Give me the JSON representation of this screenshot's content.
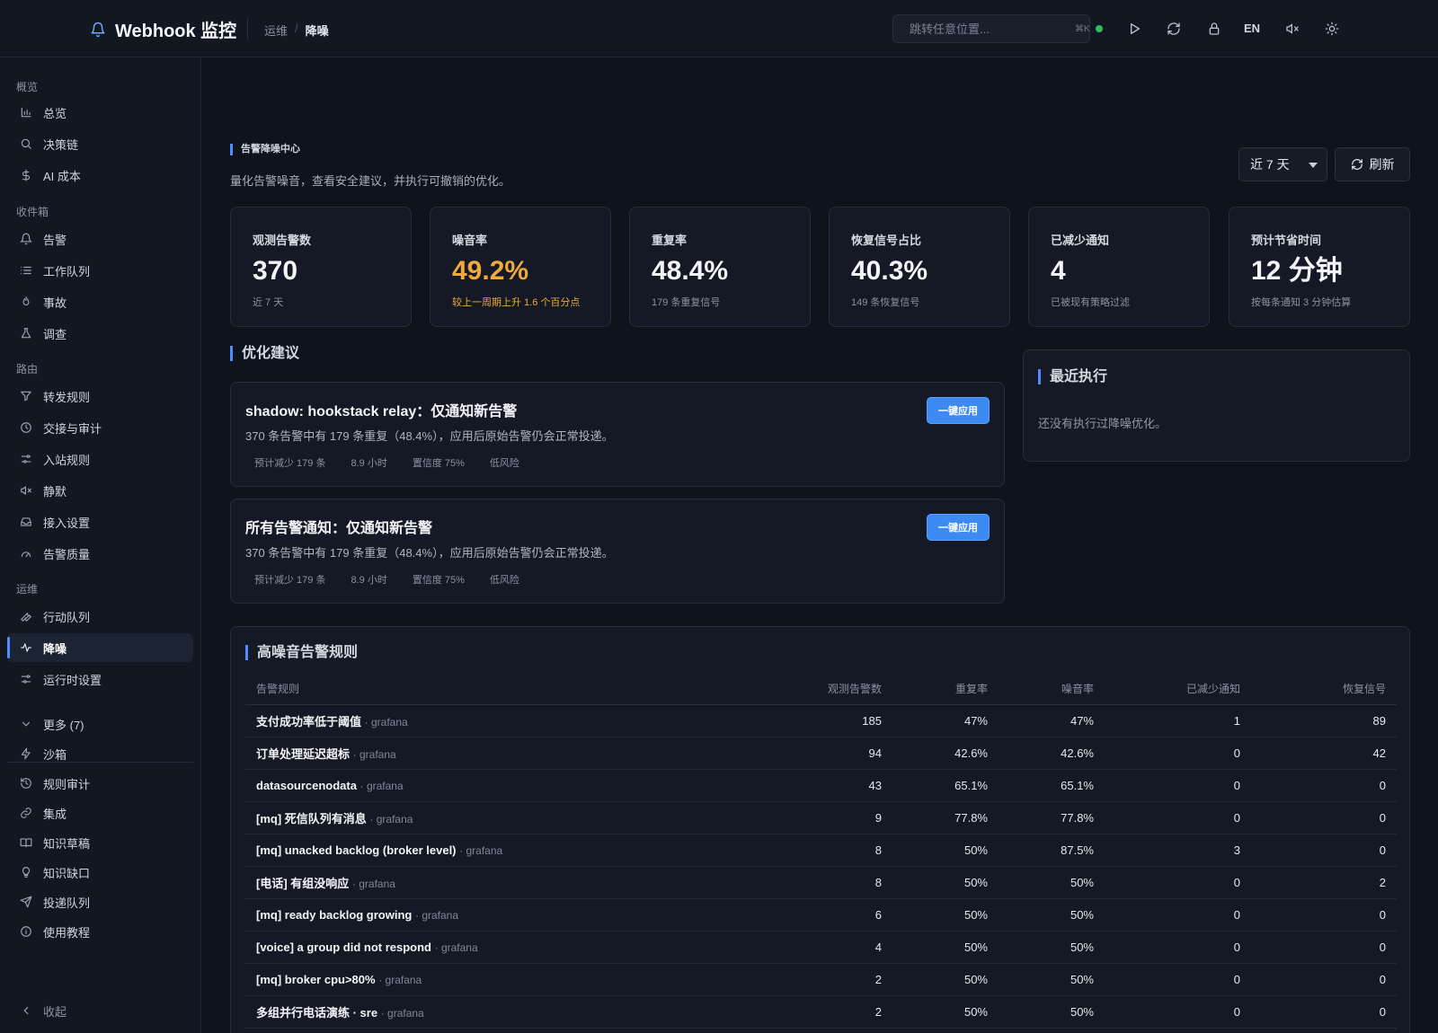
{
  "topbar": {
    "app_title": "Webhook 监控",
    "breadcrumb_parent": "运维",
    "breadcrumb_sep": "/",
    "breadcrumb_current": "降噪",
    "search_placeholder": "跳转任意位置...",
    "search_shortcut": "⌘K",
    "lang": "EN",
    "status_color": "#2fbf5a"
  },
  "sidebar": {
    "sections": [
      "概览",
      "收件箱",
      "路由",
      "运维"
    ],
    "items": [
      {
        "label": "总览",
        "icon": "bar-chart-icon"
      },
      {
        "label": "决策链",
        "icon": "search-icon"
      },
      {
        "label": "AI 成本",
        "icon": "dollar-icon"
      },
      {
        "label": "告警",
        "icon": "bell-icon"
      },
      {
        "label": "工作队列",
        "icon": "list-icon"
      },
      {
        "label": "事故",
        "icon": "flame-icon"
      },
      {
        "label": "调查",
        "icon": "flask-icon"
      },
      {
        "label": "转发规则",
        "icon": "filter-icon"
      },
      {
        "label": "交接与审计",
        "icon": "clock-icon"
      },
      {
        "label": "入站规则",
        "icon": "sliders-icon"
      },
      {
        "label": "静默",
        "icon": "mute-icon"
      },
      {
        "label": "接入设置",
        "icon": "inbox-icon"
      },
      {
        "label": "告警质量",
        "icon": "gauge-icon"
      },
      {
        "label": "行动队列",
        "icon": "wrench-icon"
      },
      {
        "label": "降噪",
        "icon": "pulse-icon"
      },
      {
        "label": "运行时设置",
        "icon": "settings-sliders-icon"
      },
      {
        "label": "更多 (7)",
        "icon": "chevron-down-icon"
      },
      {
        "label": "沙箱",
        "icon": "bolt-icon"
      },
      {
        "label": "规则审计",
        "icon": "history-icon"
      },
      {
        "label": "集成",
        "icon": "link-icon"
      },
      {
        "label": "知识草稿",
        "icon": "book-icon"
      },
      {
        "label": "知识缺口",
        "icon": "lightbulb-icon"
      },
      {
        "label": "投递队列",
        "icon": "send-icon"
      },
      {
        "label": "使用教程",
        "icon": "info-icon"
      }
    ],
    "active_item": "降噪",
    "collapse_label": "收起"
  },
  "header": {
    "section_flag": "告警降噪中心",
    "description": "量化告警噪音，查看安全建议，并执行可撤销的优化。",
    "range_value": "近 7 天",
    "refresh_label": "刷新"
  },
  "stats": [
    {
      "label": "观测告警数",
      "value": "370",
      "sub": "近 7 天"
    },
    {
      "label": "噪音率",
      "value": "49.2%",
      "sub": "较上一周期上升 1.6 个百分点",
      "tone": "warn"
    },
    {
      "label": "重复率",
      "value": "48.4%",
      "sub": "179 条重复信号"
    },
    {
      "label": "恢复信号占比",
      "value": "40.3%",
      "sub": "149 条恢复信号"
    },
    {
      "label": "已减少通知",
      "value": "4",
      "sub": "已被现有策略过滤"
    },
    {
      "label": "预计节省时间",
      "value": "12 分钟",
      "sub": "按每条通知 3 分钟估算"
    }
  ],
  "suggestions": {
    "title": "优化建议",
    "items": [
      {
        "title": "shadow: hookstack relay：仅通知新告警",
        "desc": "370 条告警中有 179 条重复（48.4%），应用后原始告警仍会正常投递。",
        "metas": [
          "预计减少 179 条",
          "8.9 小时",
          "置信度 75%",
          "低风险"
        ],
        "action": "一键应用"
      },
      {
        "title": "所有告警通知：仅通知新告警",
        "desc": "370 条告警中有 179 条重复（48.4%），应用后原始告警仍会正常投递。",
        "metas": [
          "预计减少 179 条",
          "8.9 小时",
          "置信度 75%",
          "低风险"
        ],
        "action": "一键应用"
      }
    ]
  },
  "recent": {
    "title": "最近执行",
    "empty": "还没有执行过降噪优化。"
  },
  "rules_table": {
    "title": "高噪音告警规则",
    "columns": [
      "告警规则",
      "观测告警数",
      "重复率",
      "噪音率",
      "已减少通知",
      "恢复信号"
    ],
    "rows": [
      {
        "name": "支付成功率低于阈值",
        "source": "· grafana",
        "observed": "185",
        "dup": "47%",
        "noise": "47%",
        "reduced": "1",
        "recovery": "89"
      },
      {
        "name": "订单处理延迟超标",
        "source": "· grafana",
        "observed": "94",
        "dup": "42.6%",
        "noise": "42.6%",
        "reduced": "0",
        "recovery": "42"
      },
      {
        "name": "datasourcenodata",
        "source": "· grafana",
        "observed": "43",
        "dup": "65.1%",
        "noise": "65.1%",
        "reduced": "0",
        "recovery": "0"
      },
      {
        "name": "[mq] 死信队列有消息",
        "source": "· grafana",
        "observed": "9",
        "dup": "77.8%",
        "noise": "77.8%",
        "reduced": "0",
        "recovery": "0"
      },
      {
        "name": "[mq] unacked backlog (broker level)",
        "source": "· grafana",
        "observed": "8",
        "dup": "50%",
        "noise": "87.5%",
        "reduced": "3",
        "recovery": "0"
      },
      {
        "name": "[电话] 有组没响应",
        "source": "· grafana",
        "observed": "8",
        "dup": "50%",
        "noise": "50%",
        "reduced": "0",
        "recovery": "2"
      },
      {
        "name": "[mq] ready backlog growing",
        "source": "· grafana",
        "observed": "6",
        "dup": "50%",
        "noise": "50%",
        "reduced": "0",
        "recovery": "0"
      },
      {
        "name": "[voice] a group did not respond",
        "source": "· grafana",
        "observed": "4",
        "dup": "50%",
        "noise": "50%",
        "reduced": "0",
        "recovery": "0"
      },
      {
        "name": "[mq] broker cpu>80%",
        "source": "· grafana",
        "observed": "2",
        "dup": "50%",
        "noise": "50%",
        "reduced": "0",
        "recovery": "0"
      },
      {
        "name": "多组并行电话演练 · sre",
        "source": "· grafana",
        "observed": "2",
        "dup": "50%",
        "noise": "50%",
        "reduced": "0",
        "recovery": "0"
      }
    ]
  },
  "colors": {
    "accent": "#4c8dff",
    "warn": "#f0a93a",
    "primary_button": "#3d8bf2",
    "background": "#0f131b"
  }
}
